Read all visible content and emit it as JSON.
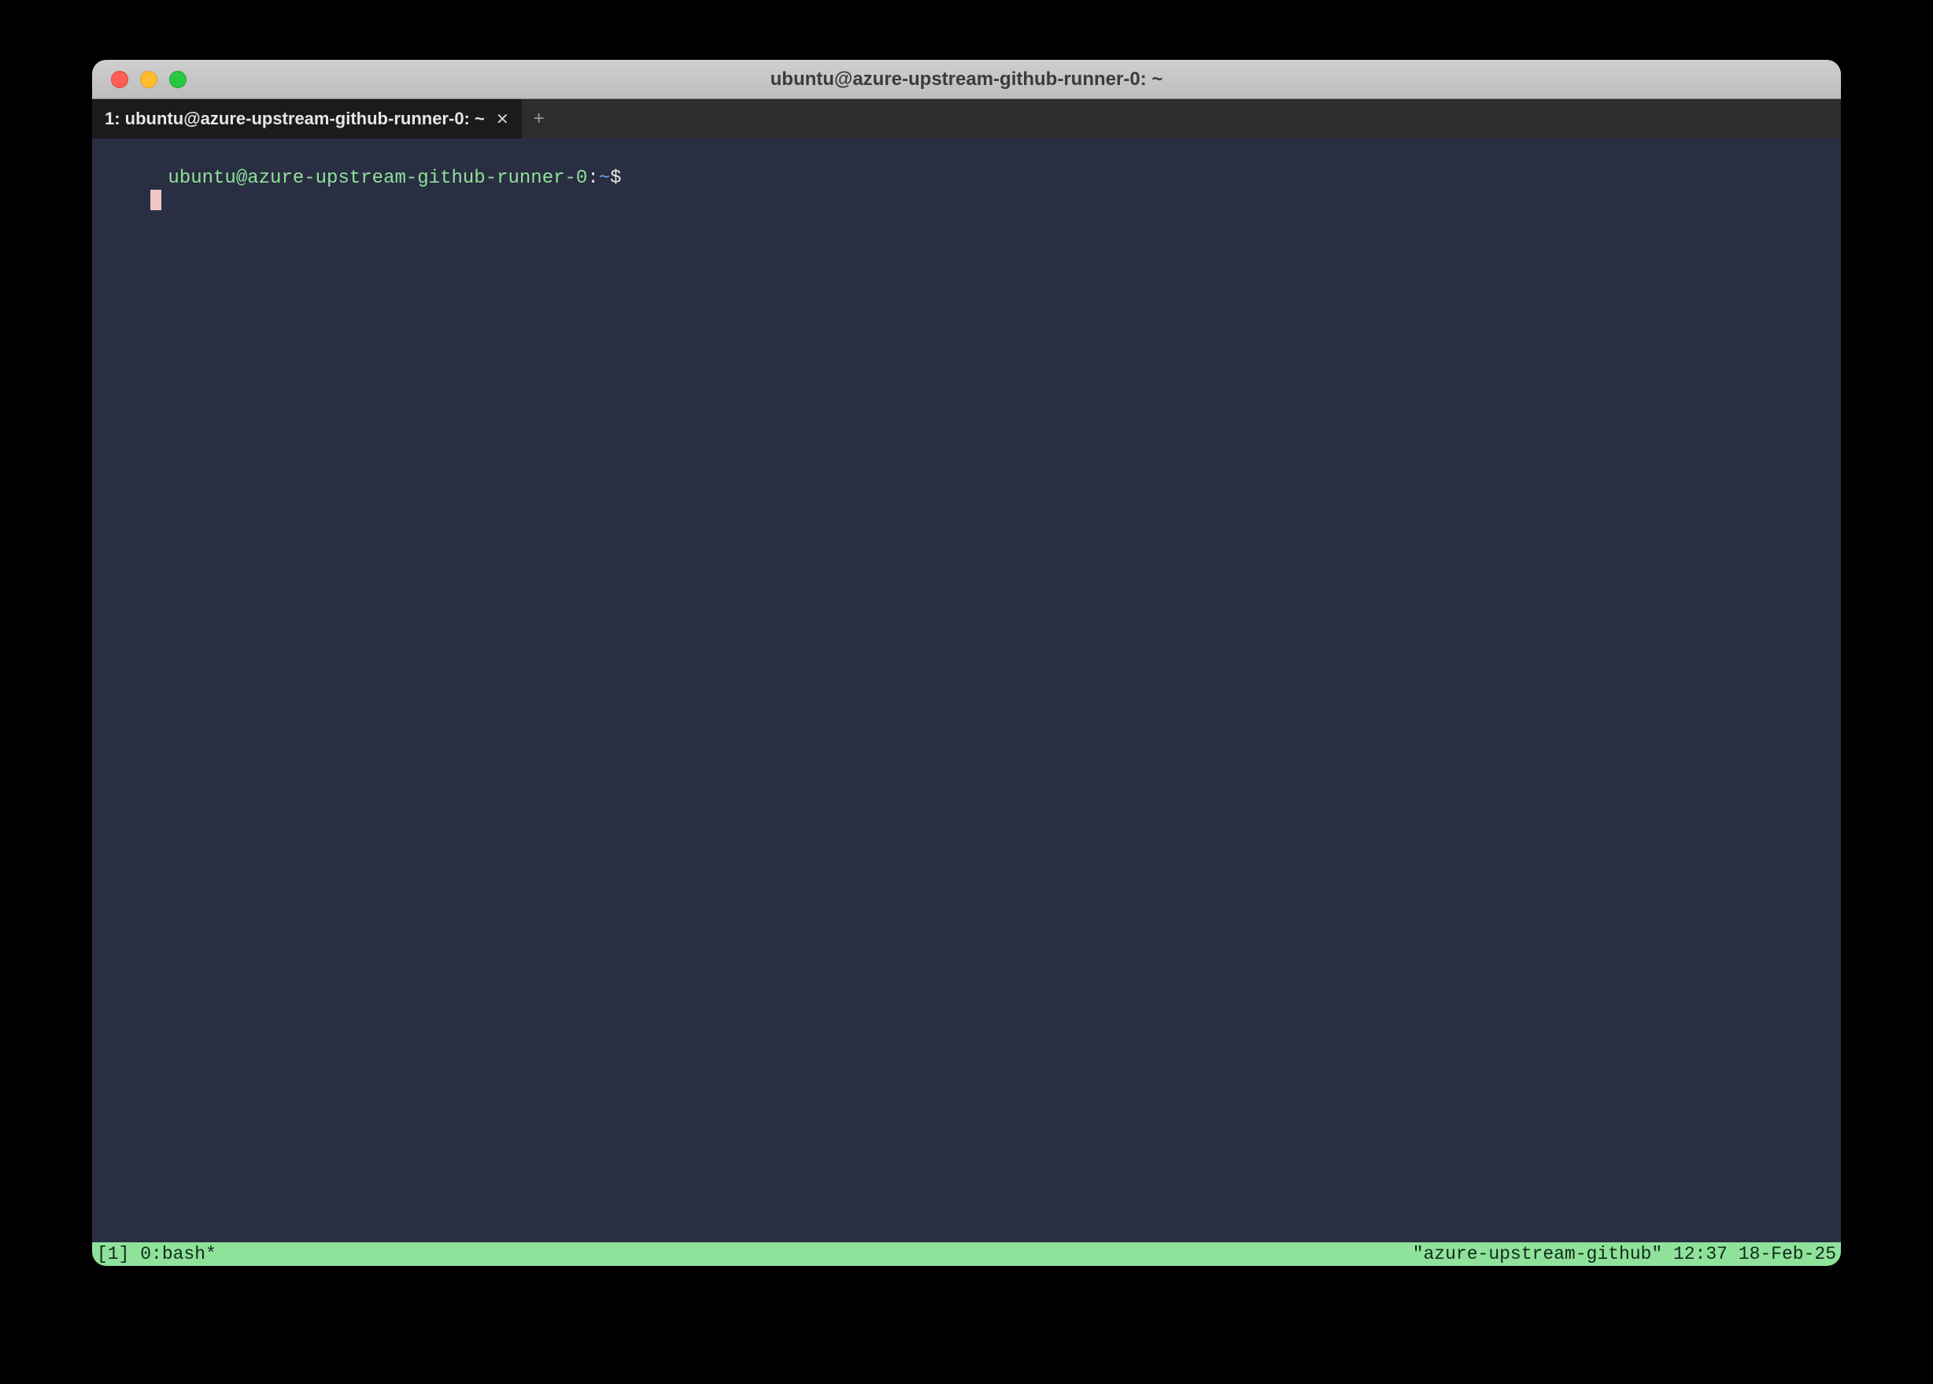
{
  "window": {
    "title": "ubuntu@azure-upstream-github-runner-0: ~"
  },
  "tabs": [
    {
      "label": "1: ubuntu@azure-upstream-github-runner-0: ~"
    }
  ],
  "tab_add_glyph": "+",
  "tab_close_glyph": "✕",
  "prompt": {
    "host": "ubuntu@azure-upstream-github-runner-0",
    "colon": ":",
    "path": "~",
    "dollar": "$"
  },
  "statusbar": {
    "left": "[1] 0:bash*",
    "right": "\"azure-upstream-github\" 12:37 18-Feb-25"
  }
}
